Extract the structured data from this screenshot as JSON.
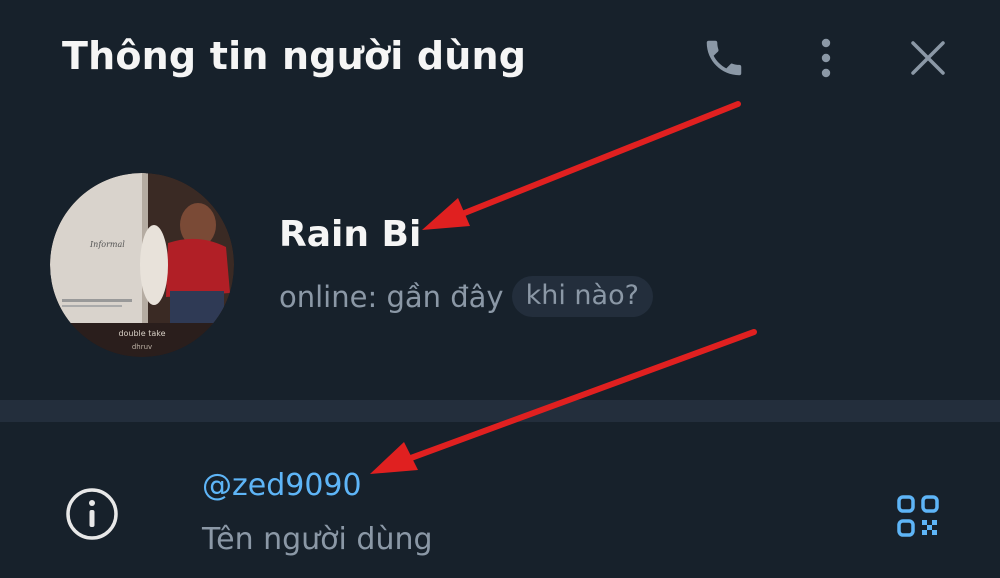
{
  "header": {
    "title": "Thông tin người dùng",
    "call_icon": "phone-icon",
    "more_icon": "more-vertical-icon",
    "close_icon": "close-icon"
  },
  "profile": {
    "name": "Rain Bi",
    "status": "online: gần đây",
    "status_chip": "khi nào?",
    "avatar_caption": "double take",
    "avatar_caption_sub": "dhruv"
  },
  "info": {
    "username": "@zed9090",
    "username_label": "Tên người dùng",
    "info_icon": "info-icon",
    "qr_icon": "qr-code-icon"
  },
  "colors": {
    "background": "#17212b",
    "divider": "#232e3c",
    "link": "#5eb5f7",
    "muted": "#8b98a6",
    "annotation_arrow": "#e02020"
  }
}
